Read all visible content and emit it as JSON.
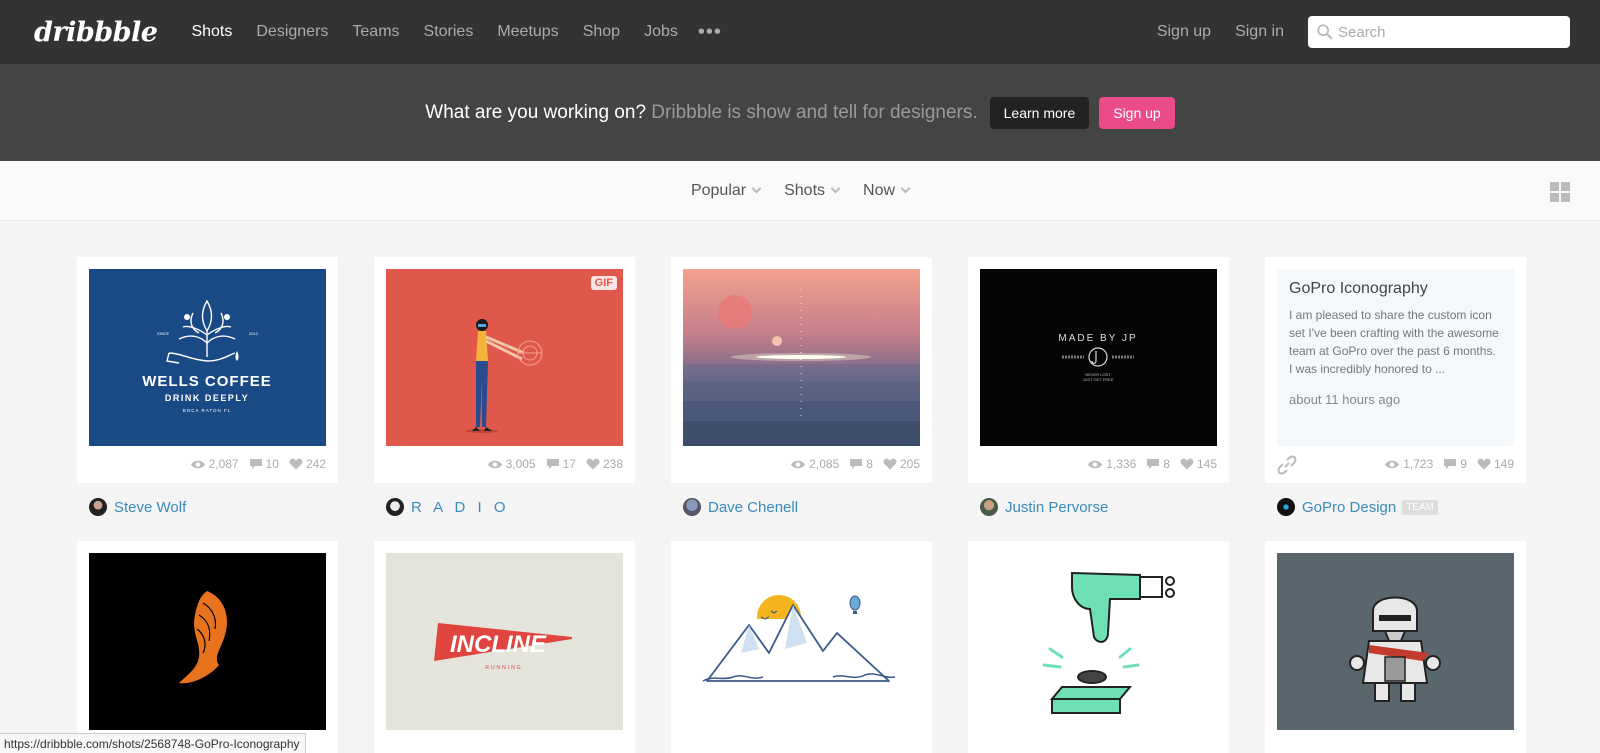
{
  "header": {
    "logo": "dribbble",
    "nav": [
      "Shots",
      "Designers",
      "Teams",
      "Stories",
      "Meetups",
      "Shop",
      "Jobs"
    ],
    "more": "•••",
    "signup": "Sign up",
    "signin": "Sign in",
    "search_placeholder": "Search"
  },
  "banner": {
    "question": "What are you working on?",
    "tagline": "Dribbble is show and tell for designers.",
    "learn_more": "Learn more",
    "signup": "Sign up"
  },
  "filters": [
    "Popular",
    "Shots",
    "Now"
  ],
  "shots_row1": [
    {
      "author": "Steve Wolf",
      "views": "2,087",
      "comments": "10",
      "likes": "242"
    },
    {
      "author": "R A D I O",
      "views": "3,005",
      "comments": "17",
      "likes": "238",
      "badge": "GIF"
    },
    {
      "author": "Dave Chenell",
      "views": "2,085",
      "comments": "8",
      "likes": "205"
    },
    {
      "author": "Justin Pervorse",
      "views": "1,336",
      "comments": "8",
      "likes": "145"
    },
    {
      "author": "GoPro Design",
      "team": "TEAM",
      "views": "1,723",
      "comments": "9",
      "likes": "149",
      "title": "GoPro Iconography",
      "description": "I am pleased to share the custom icon set I've been crafting with the awesome team at GoPro over the past 6 months. I was incredibly honored to ...",
      "time": "about 11 hours ago"
    }
  ],
  "art_text": {
    "wells_1": "WELLS COFFEE",
    "wells_2": "DRINK DEEPLY",
    "wells_3": "BOCA RATON FL",
    "wells_since": "SINCE",
    "wells_year": "2012",
    "madeby": "MADE BY JP",
    "madeby_sub1": "NEVER LOST",
    "madeby_sub2": "JUST GET FREE",
    "incline": "INCLINE",
    "incline_sub": "RUNNING"
  },
  "status_url": "https://dribbble.com/shots/2568748-GoPro-Iconography",
  "colors": {
    "header_bg": "#333333",
    "banner_bg": "#444444",
    "pink": "#ea4c89",
    "link": "#3a8bbb"
  }
}
